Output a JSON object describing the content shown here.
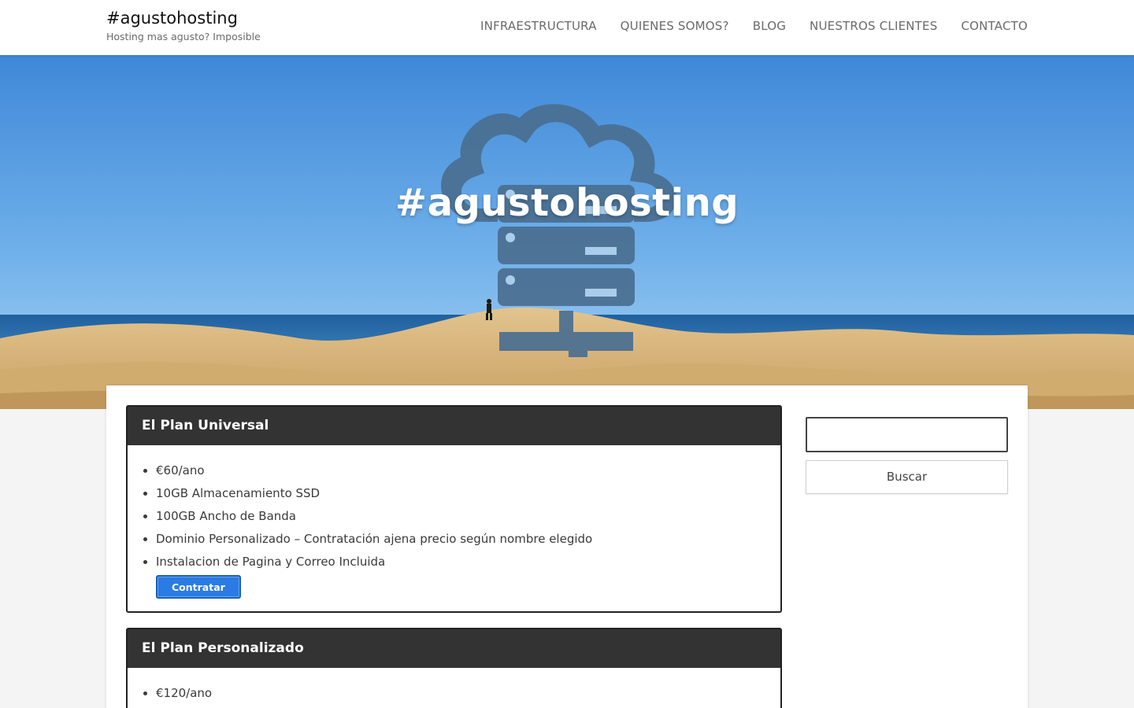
{
  "header": {
    "site_title": "#agustohosting",
    "site_description": "Hosting mas agusto? Imposible",
    "nav": [
      {
        "label": "INFRAESTRUCTURA"
      },
      {
        "label": "QUIENES SOMOS?"
      },
      {
        "label": "BLOG"
      },
      {
        "label": "NUESTROS CLIENTES"
      },
      {
        "label": "CONTACTO"
      }
    ]
  },
  "hero": {
    "title": "#agustohosting",
    "icon": "cloud-server-icon"
  },
  "plans": [
    {
      "title": "El Plan Universal",
      "features": [
        "€60/ano",
        "10GB Almacenamiento SSD",
        "100GB Ancho de Banda",
        "Dominio Personalizado – Contratación ajena precio según nombre elegido",
        "Instalacion de Pagina y Correo Incluida"
      ],
      "button": "Contratar"
    },
    {
      "title": "El Plan Personalizado",
      "features": [
        "€120/ano"
      ]
    }
  ],
  "sidebar": {
    "search_placeholder": "",
    "search_button": "Buscar"
  },
  "colors": {
    "button_blue": "#2a7be4",
    "plan_header": "#333333"
  }
}
